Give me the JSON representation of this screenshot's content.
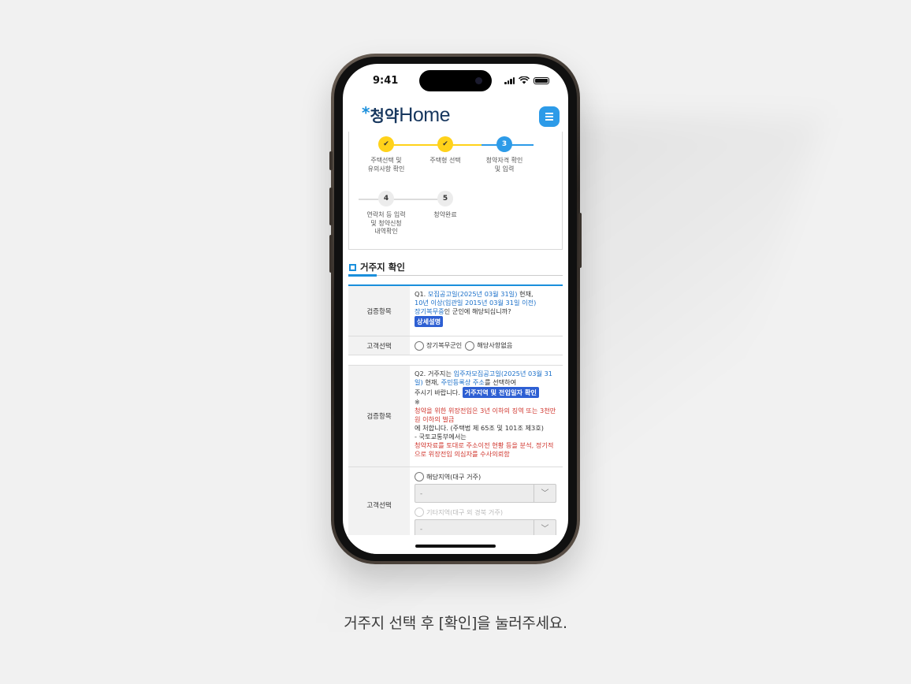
{
  "status_bar": {
    "time": "9:41"
  },
  "header": {
    "logo_star": "*",
    "logo_kr": "청약",
    "logo_en": "Home",
    "menu_icon": "hamburger-icon"
  },
  "steps": [
    {
      "number": "",
      "state": "done",
      "label_lines": [
        "주택선택 및",
        "유의사항 확인"
      ]
    },
    {
      "number": "",
      "state": "done",
      "label_lines": [
        "주택형 선택"
      ]
    },
    {
      "number": "3",
      "state": "current",
      "label_lines": [
        "청약자격 확인",
        "및 입력"
      ]
    },
    {
      "number": "4",
      "state": "todo",
      "label_lines": [
        "연락처 등 입력",
        "및 청약신청",
        "내역확인"
      ]
    },
    {
      "number": "5",
      "state": "todo",
      "label_lines": [
        "청약완료"
      ]
    }
  ],
  "section": {
    "title": "거주지 확인"
  },
  "q1": {
    "th_item": "검증항목",
    "prefix": "Q1. ",
    "blue1": "모집공고일(2025년 03월 31일)",
    "t1": " 현재,",
    "blue2": "10년 이상(입관일 2015년 03월 31일 이전)",
    "blue3": "장기복무중",
    "t2": "인 군인에 해당되십니까?",
    "badge": "상세설명",
    "th_select": "고객선택",
    "option1": "장기복무군인",
    "option2": "해당사항없음"
  },
  "q2": {
    "th_item": "검증항목",
    "prefix": "Q2. 거주지는 ",
    "blue1": "입주자모집공고일(2025년 03월 31일)",
    "t1": " 현재, ",
    "blue2": "주민등록상 주소",
    "t2": "를 선택하여",
    "t3": "주시기 바랍니다. ",
    "badge": "거주지역 및 전입일자 확인",
    "note_mark": "※",
    "red1": "청약을 위한 위장전입은 3년 이하의 징역 또는 3천만원 이하의 벌금",
    "t4": "에 처합니다. (주택법 제 65조 및 101조 제3호)",
    "t5": "- 국토교통부에서는",
    "red2": "청약자료를 토대로 주소이전 현황 등을 분석, 정기적으로 위장전입 의심자를 수사의뢰함",
    "th_select": "고객선택",
    "option1": "해당지역(대구 거주)",
    "select1": "-",
    "option2": "기타지역(대구 외 경북 거주)",
    "select2": "-"
  },
  "caption": "거주지 선택 후 [확인]을 눌러주세요."
}
